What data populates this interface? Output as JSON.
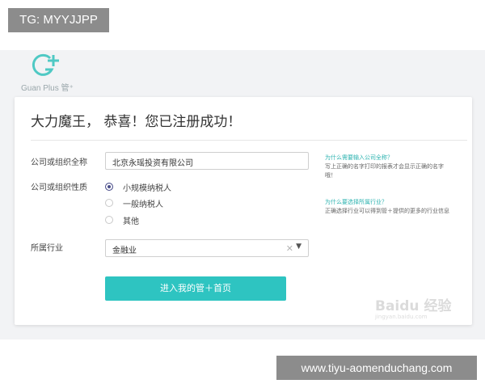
{
  "overlay": {
    "tag": "TG: MYYJJPP",
    "url": "www.tiyu-aomenduchang.com"
  },
  "logo": {
    "text": "Guan Plus 管⁺",
    "brand_color": "#4fc9c4"
  },
  "card": {
    "title": "大力魔王， 恭喜！您已注册成功！",
    "org_name_label": "公司或组织全称",
    "org_name_value": "北京永瑶投资有限公司",
    "org_type_label": "公司或组织性质",
    "org_type_options": [
      {
        "label": "小规模纳税人",
        "selected": true
      },
      {
        "label": "一般纳税人",
        "selected": false
      },
      {
        "label": "其他",
        "selected": false
      }
    ],
    "industry_label": "所属行业",
    "industry_value": "金融业",
    "submit_label": "进入我的管＋首页",
    "help": [
      {
        "title": "为什么需要输入公司全称？",
        "body": "写上正确的名字打印的报表才会显示正确的名字哦！"
      },
      {
        "title": "为什么要选择所属行业？",
        "body": "正确选择行业可以得到管＋提供的更多的行业信息"
      }
    ]
  },
  "watermark": {
    "brand": "Baidu 经验",
    "sub": "jingyan.baidu.com"
  },
  "colors": {
    "accent": "#2ec4c1",
    "help_link": "#2db3b0",
    "overlay_bg": "#8c8c8c"
  }
}
